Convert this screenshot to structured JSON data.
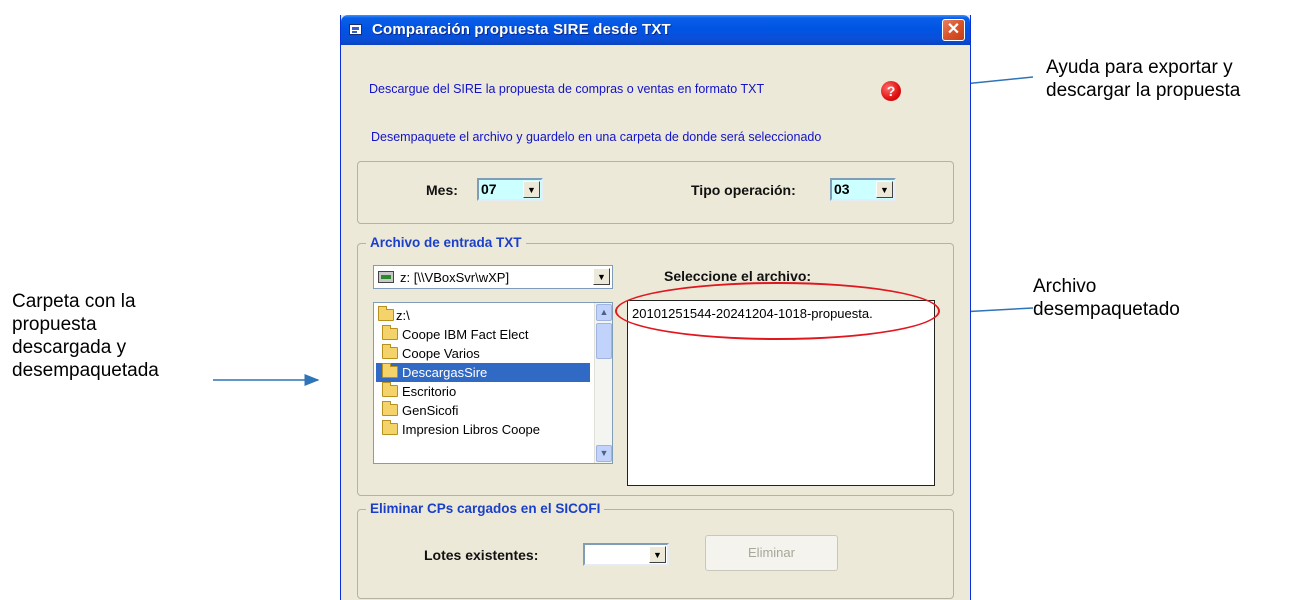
{
  "window": {
    "title": "Comparación propuesta SIRE desde TXT",
    "close_glyph": "✕"
  },
  "info": {
    "line1": "Descargue del SIRE la propuesta de compras o ventas  en formato TXT",
    "line2": "Desempaquete el archivo y guardelo en una carpeta de donde será seleccionado",
    "help_glyph": "?"
  },
  "filters": {
    "mes_label": "Mes:",
    "mes_value": "07",
    "tipo_label": "Tipo operación:",
    "tipo_value": "03"
  },
  "input_group": {
    "legend": "Archivo de entrada TXT",
    "drive_value": "z: [\\\\VBoxSvr\\wXP]",
    "select_file_label": "Seleccione el archivo:",
    "folders": [
      "z:\\",
      "Coope IBM Fact Elect",
      "Coope Varios",
      "DescargasSire",
      "Escritorio",
      "GenSicofi",
      "Impresion Libros Coope"
    ],
    "selected_folder_index": 3,
    "files": [
      "20101251544-20241204-1018-propuesta."
    ]
  },
  "delete_group": {
    "legend": "Eliminar CPs cargados en el SICOFI",
    "lotes_label": "Lotes existentes:",
    "lotes_value": "",
    "delete_button": "Eliminar"
  },
  "annotations": {
    "help_note_line1": "Ayuda para exportar y",
    "help_note_line2": "descargar la propuesta",
    "file_note_line1": "Archivo",
    "file_note_line2": "desempaquetado",
    "folder_note_line1": "Carpeta con la",
    "folder_note_line2": "propuesta",
    "folder_note_line3": "descargada y",
    "folder_note_line4": "desempaquetada"
  },
  "colors": {
    "titlebar": "#0054e3",
    "info_text": "#1212c8",
    "legend_text": "#1a3fc8",
    "selection": "#316ac5",
    "highlight_ellipse": "#e0171f",
    "annotation_arrow": "#2f73b8"
  },
  "icons": {
    "help": "help-icon",
    "close": "close-icon",
    "folder": "folder-icon",
    "drive": "network-drive-icon",
    "dropdown": "chevron-down-icon"
  }
}
